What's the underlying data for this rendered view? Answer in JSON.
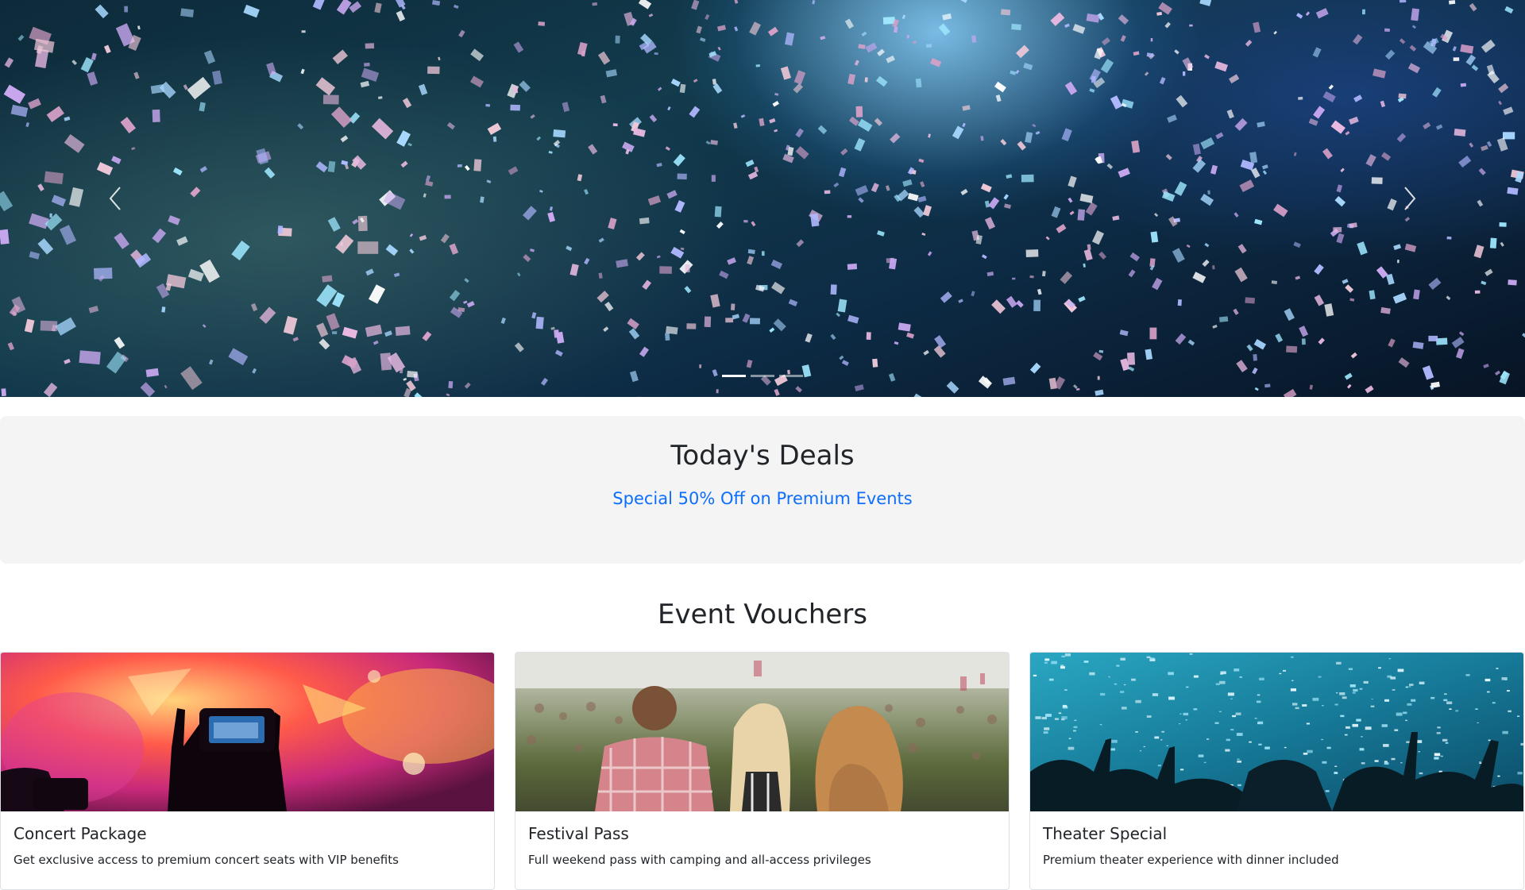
{
  "hero": {
    "prev_icon": "chevron-left-icon",
    "next_icon": "chevron-right-icon",
    "slides": [
      {
        "state": "active"
      },
      {
        "state": "inactive"
      },
      {
        "state": "inactive"
      }
    ]
  },
  "deals": {
    "title": "Today's Deals",
    "subtitle": "Special 50% Off on Premium Events"
  },
  "vouchers": {
    "title": "Event Vouchers",
    "cards": [
      {
        "title": "Concert Package",
        "text": "Get exclusive access to premium concert seats with VIP benefits"
      },
      {
        "title": "Festival Pass",
        "text": "Full weekend pass with camping and all-access privileges"
      },
      {
        "title": "Theater Special",
        "text": "Premium theater experience with dinner included"
      }
    ]
  },
  "colors": {
    "accent": "#0d6efd",
    "deals_background": "#f4f4f4"
  }
}
